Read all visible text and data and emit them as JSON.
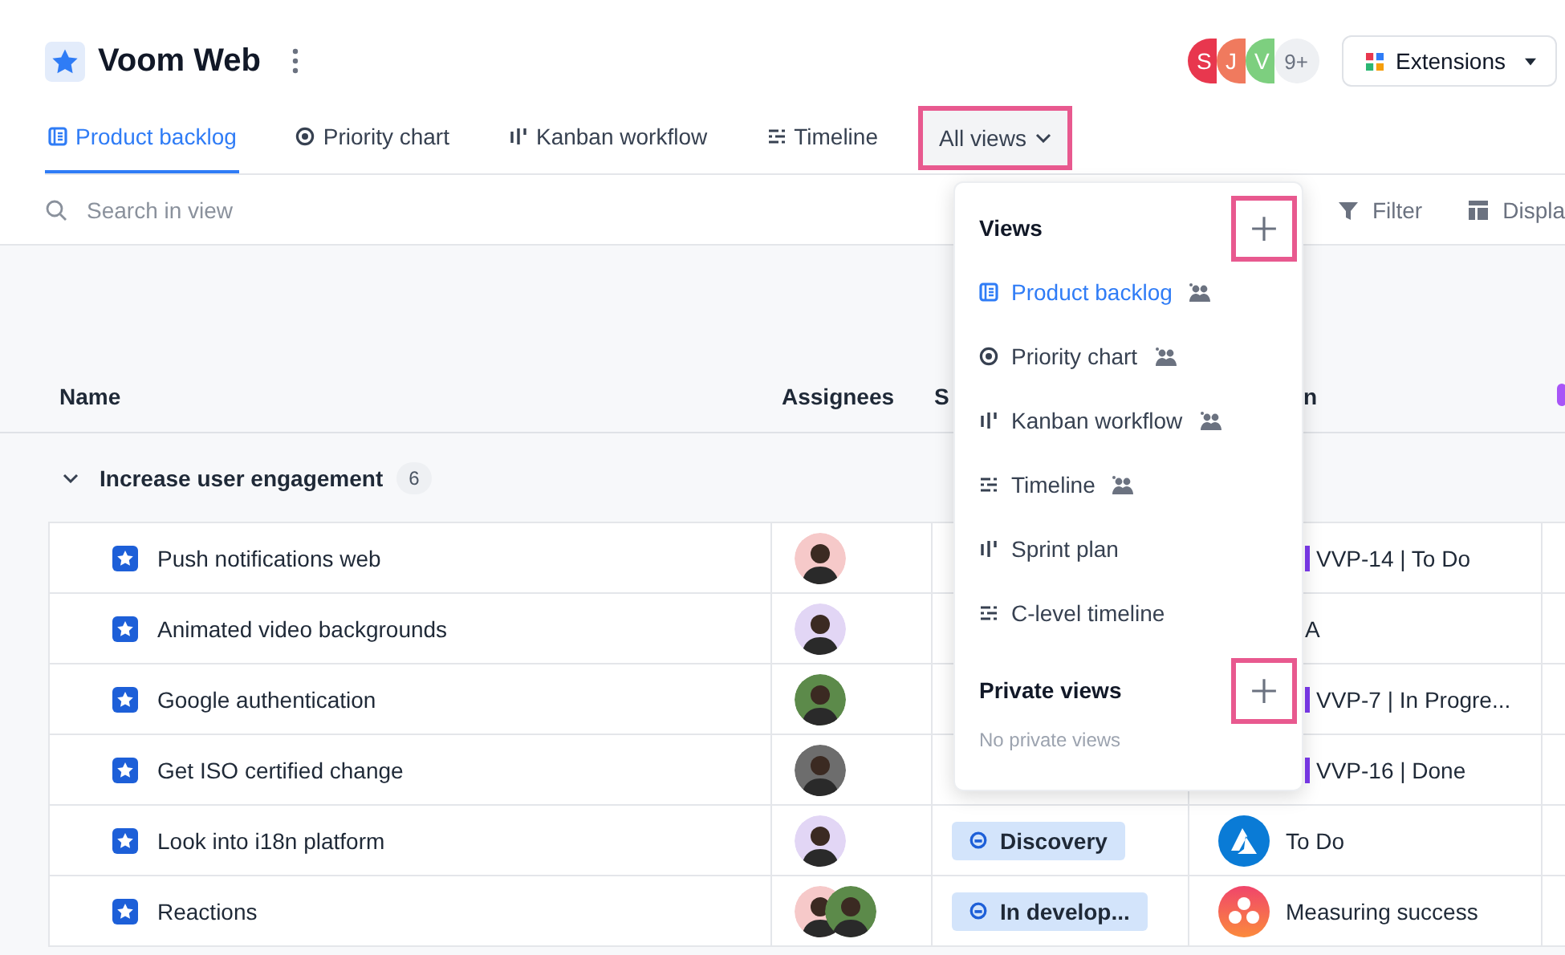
{
  "project": {
    "title": "Voom Web"
  },
  "collaborators": [
    {
      "initial": "S",
      "color": "#e8374e"
    },
    {
      "initial": "J",
      "color": "#f07a5e"
    },
    {
      "initial": "V",
      "color": "#7dcf7f"
    }
  ],
  "collaborators_more": "9+",
  "extensions_button": "Extensions",
  "tabs": [
    {
      "label": "Product backlog",
      "kind": "list",
      "selected": true
    },
    {
      "label": "Priority chart",
      "kind": "target",
      "selected": false
    },
    {
      "label": "Kanban workflow",
      "kind": "kanban",
      "selected": false
    },
    {
      "label": "Timeline",
      "kind": "timeline",
      "selected": false
    }
  ],
  "all_views_button": {
    "label": "All views",
    "expanded": true
  },
  "toolbar": {
    "search_placeholder": "Search in view",
    "actions": [
      {
        "label": "Filter",
        "kind": "filter"
      },
      {
        "label": "Displa",
        "kind": "display"
      }
    ]
  },
  "table": {
    "columns": [
      "Name",
      "Assignees",
      "S",
      "n"
    ],
    "group": {
      "label": "Increase user engagement",
      "count": "6",
      "expanded": true
    },
    "rows": [
      {
        "name": "Push notifications web",
        "assignees": [
          {
            "color": "#f6c9c9"
          }
        ],
        "integration": {
          "kind": "jira",
          "text": "VVP-14 | To Do"
        }
      },
      {
        "name": "Animated video backgrounds",
        "assignees": [
          {
            "color": "#e2d6f5"
          }
        ],
        "integration": {
          "kind": "plain",
          "text": "A"
        }
      },
      {
        "name": "Google authentication",
        "assignees": [
          {
            "color": "#5c8a4a"
          }
        ],
        "integration": {
          "kind": "jira",
          "text": "VVP-7 | In Progre..."
        }
      },
      {
        "name": "Get ISO certified change",
        "assignees": [
          {
            "color": "#6d6d6d"
          }
        ],
        "integration": {
          "kind": "jira",
          "text": "VVP-16 | Done"
        }
      },
      {
        "name": "Look into i18n platform",
        "assignees": [
          {
            "color": "#e2d6f5"
          }
        ],
        "status": {
          "label": "Discovery"
        },
        "integration": {
          "kind": "azure",
          "text": "To Do"
        }
      },
      {
        "name": "Reactions",
        "assignees": [
          {
            "color": "#f6c9c9"
          },
          {
            "color": "#5c8a4a"
          }
        ],
        "status": {
          "label": "In develop..."
        },
        "integration": {
          "kind": "asana",
          "text": "Measuring success"
        }
      }
    ]
  },
  "views_menu": {
    "sections": [
      {
        "title": "Views",
        "items": [
          {
            "label": "Product backlog",
            "kind": "list",
            "shared": true,
            "selected": true
          },
          {
            "label": "Priority chart",
            "kind": "target",
            "shared": true,
            "selected": false
          },
          {
            "label": "Kanban workflow",
            "kind": "kanban",
            "shared": true,
            "selected": false
          },
          {
            "label": "Timeline",
            "kind": "timeline",
            "shared": true,
            "selected": false
          },
          {
            "label": "Sprint plan",
            "kind": "kanban",
            "shared": false,
            "selected": false
          },
          {
            "label": "C-level timeline",
            "kind": "timeline",
            "shared": false,
            "selected": false
          }
        ]
      },
      {
        "title": "Private views",
        "empty_text": "No private views"
      }
    ]
  }
}
